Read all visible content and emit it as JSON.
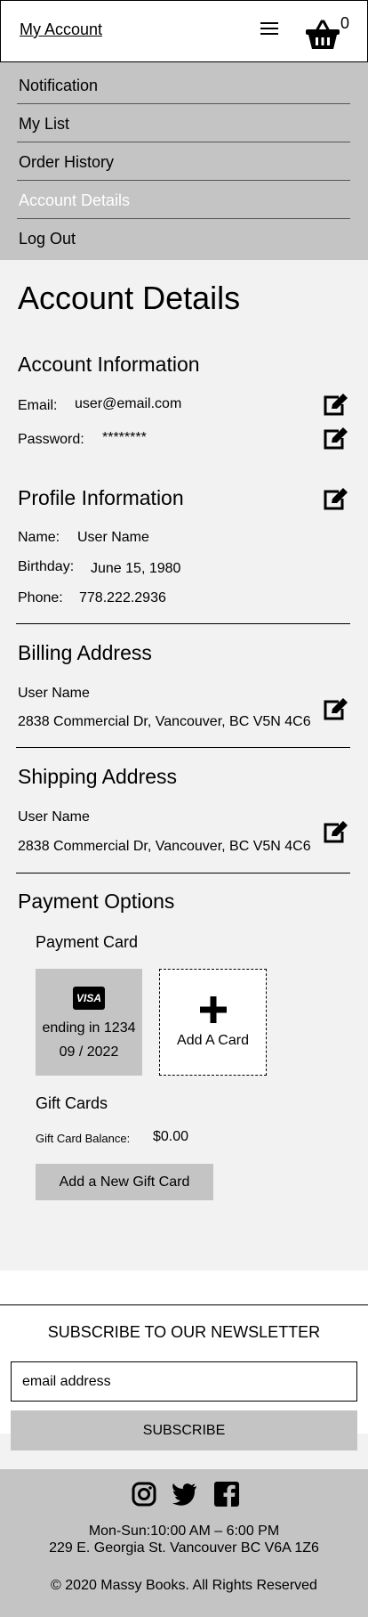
{
  "header": {
    "title": "My Account",
    "cart_count": "0",
    "menu_icon": "hamburger-menu-icon",
    "cart_icon": "shopping-basket-icon"
  },
  "nav": {
    "items": [
      {
        "label": "Notification"
      },
      {
        "label": "My List"
      },
      {
        "label": "Order History"
      },
      {
        "label": "Account Details"
      },
      {
        "label": "Log Out"
      }
    ],
    "active_label": "Account Details"
  },
  "page": {
    "title": "Account Details"
  },
  "account_info": {
    "heading": "Account Information",
    "email_label": "Email:",
    "email_value": "user@email.com",
    "password_label": "Password:",
    "password_value": "********"
  },
  "profile_info": {
    "heading": "Profile Information",
    "name_label": "Name:",
    "name_value": "User Name",
    "birthday_label": "Birthday:",
    "birthday_value": "June 15, 1980",
    "phone_label": "Phone:",
    "phone_value": "778.222.2936"
  },
  "billing": {
    "heading": "Billing Address",
    "name": "User Name",
    "address": "2838 Commercial Dr, Vancouver, BC V5N 4C6"
  },
  "shipping": {
    "heading": "Shipping Address",
    "name": "User Name",
    "address": "2838 Commercial Dr, Vancouver, BC V5N 4C6"
  },
  "payment": {
    "heading": "Payment Options",
    "card_heading": "Payment Card",
    "card_brand": "VISA",
    "card_ending": "ending in 1234",
    "card_expiry": "09 / 2022",
    "add_card_label": "Add A Card",
    "gift_heading": "Gift Cards",
    "gift_balance_label": "Gift Card Balance:",
    "gift_balance_value": "$0.00",
    "add_gift_label": "Add a New Gift Card"
  },
  "newsletter": {
    "title": "SUBSCRIBE TO OUR NEWSLETTER",
    "email_placeholder": "email address",
    "subscribe_label": "SUBSCRIBE"
  },
  "footer": {
    "hours": "Mon-Sun:10:00 AM – 6:00 PM",
    "address": "229 E. Georgia St. Vancouver BC  V6A 1Z6",
    "copyright": "© 2020 Massy Books. All Rights Reserved",
    "social_icons": [
      "instagram-icon",
      "twitter-icon",
      "facebook-icon"
    ]
  }
}
